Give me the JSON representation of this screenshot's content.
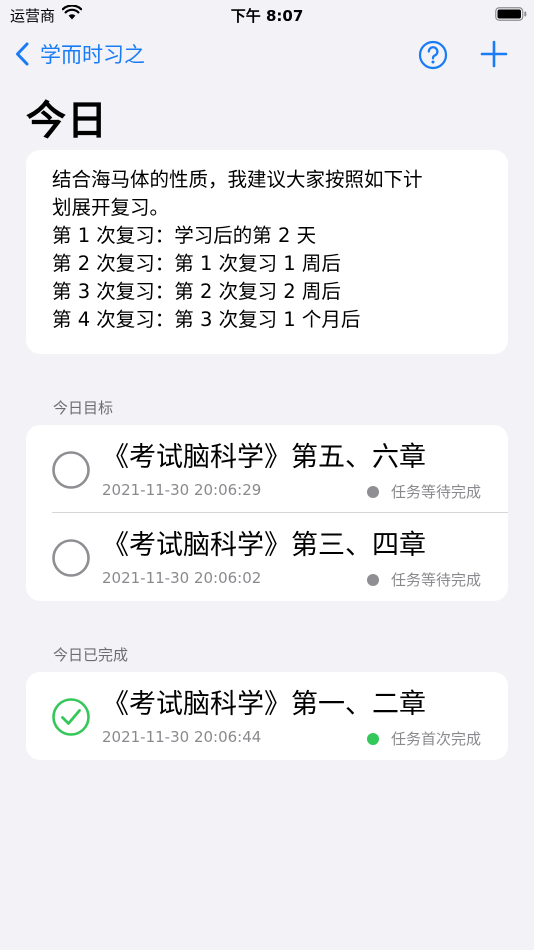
{
  "status_bar": {
    "carrier": "运营商",
    "time": "下午 8:07"
  },
  "nav": {
    "back_label": "学而时习之"
  },
  "page_title": "今日",
  "note": {
    "lines": [
      "结合海马体的性质，我建议大家按照如下计",
      "划展开复习。",
      "第 1 次复习：学习后的第 2 天",
      "第 2 次复习：第 1 次复习 1 周后",
      "第 3 次复习：第 2 次复习 2 周后",
      "第 4 次复习：第 3 次复习 1 个月后"
    ]
  },
  "today_goals": {
    "header": "今日目标",
    "items": [
      {
        "title": "《考试脑科学》第五、六章",
        "time": "2021-11-30 20:06:29",
        "status": "任务等待完成",
        "status_color": "#8e8e93",
        "done": false
      },
      {
        "title": "《考试脑科学》第三、四章",
        "time": "2021-11-30 20:06:02",
        "status": "任务等待完成",
        "status_color": "#8e8e93",
        "done": false
      }
    ]
  },
  "today_done": {
    "header": "今日已完成",
    "items": [
      {
        "title": "《考试脑科学》第一、二章",
        "time": "2021-11-30 20:06:44",
        "status": "任务首次完成",
        "status_color": "#34c759",
        "done": true
      }
    ]
  },
  "colors": {
    "accent": "#1a7cf5",
    "pending": "#8e8e93",
    "success": "#34c759",
    "background": "#f2f2f7"
  }
}
